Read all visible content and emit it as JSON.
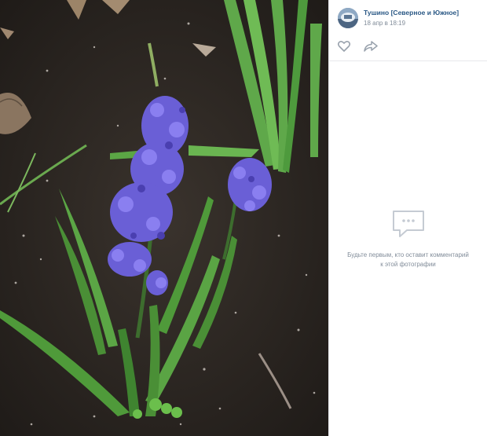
{
  "owner": {
    "name": "Тушино [Северное и Южное]",
    "date": "18 апр в 18:19",
    "avatar_icon": "community-avatar"
  },
  "actions": [
    {
      "icon": "heart-icon"
    },
    {
      "icon": "share-icon"
    }
  ],
  "comments": {
    "empty_icon": "comment-bubble-icon",
    "empty_text": "Будьте первым, кто оставит комментарий к этой фотографии"
  },
  "colors": {
    "link": "#2a5885",
    "muted": "#818c99",
    "icon": "#99a2ad",
    "flower": "#6a5fd6",
    "leaf": "#4f9a3a"
  }
}
